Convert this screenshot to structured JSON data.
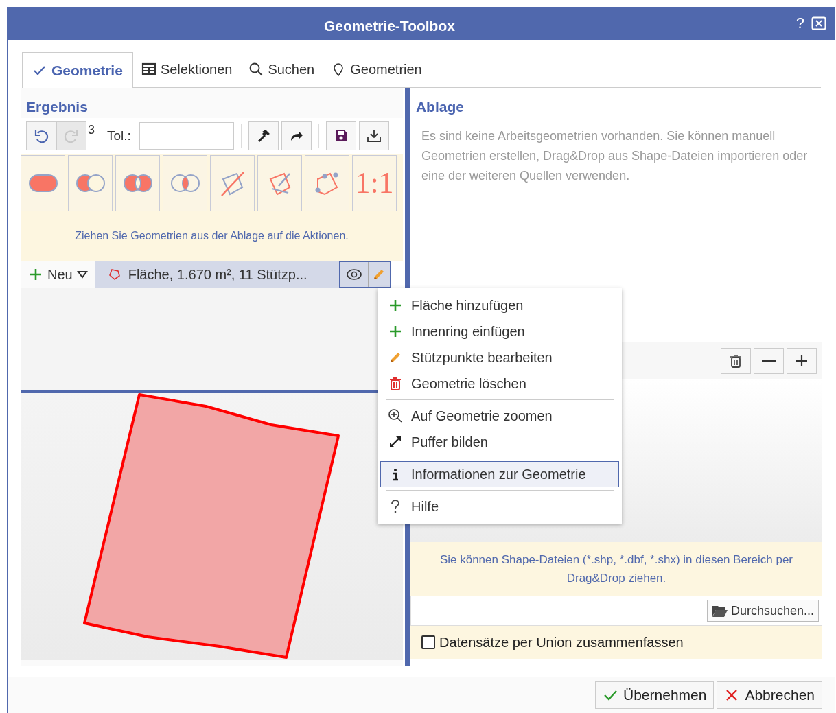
{
  "window": {
    "title": "Geometrie-Toolbox",
    "help": "?"
  },
  "tabs": [
    {
      "label": "Geometrie",
      "kind": "check",
      "selected": true
    },
    {
      "label": "Selektionen",
      "kind": "table",
      "selected": false
    },
    {
      "label": "Suchen",
      "kind": "search",
      "selected": false
    },
    {
      "label": "Geometrien",
      "kind": "pin",
      "selected": false
    }
  ],
  "result": {
    "title": "Ergebnis",
    "undo_count": "3",
    "tolerance_label": "Tol.:",
    "toolbar": [
      {
        "kind": "undo",
        "disabled": false
      },
      {
        "kind": "redo",
        "disabled": true
      }
    ],
    "tools": [
      {
        "kind": "hammer"
      },
      {
        "kind": "share"
      },
      {
        "kind": "save"
      },
      {
        "kind": "download"
      }
    ],
    "actions": [
      {
        "kind": "union"
      },
      {
        "kind": "difference"
      },
      {
        "kind": "symdiff"
      },
      {
        "kind": "intersect"
      },
      {
        "kind": "split"
      },
      {
        "kind": "cut"
      },
      {
        "kind": "vertices"
      },
      {
        "kind": "text",
        "label": "1:1"
      }
    ],
    "hint": "Ziehen Sie Geometrien aus der Ablage auf die Aktionen.",
    "new_button": "Neu",
    "geometry": {
      "label": "Fläche, 1.670 m², 11 Stützp..."
    }
  },
  "menu": [
    [
      {
        "label": "Fläche hinzufügen",
        "kind": "plus",
        "selected": false
      },
      {
        "label": "Innenring einfügen",
        "kind": "plus",
        "selected": false
      },
      {
        "label": "Stützpunkte bearbeiten",
        "kind": "pencil",
        "selected": false
      },
      {
        "label": "Geometrie löschen",
        "kind": "trash",
        "selected": false
      }
    ],
    [
      {
        "label": "Auf Geometrie zoomen",
        "kind": "zoom",
        "selected": false
      },
      {
        "label": "Puffer bilden",
        "kind": "expand",
        "selected": false
      }
    ],
    [
      {
        "label": "Informationen zur Geometrie",
        "kind": "info",
        "selected": true
      }
    ],
    [
      {
        "label": "Hilfe",
        "kind": "help",
        "selected": false
      }
    ]
  ],
  "storage": {
    "title": "Ablage",
    "message": "Es sind keine Arbeitsgeometrien vorhanden. Sie können manuell Geometrien erstellen, Drag&Drop aus Shape-Dateien importieren oder eine der weiteren Quellen verwenden.",
    "tools": [
      {
        "kind": "trash"
      },
      {
        "kind": "minus"
      },
      {
        "kind": "plus"
      }
    ],
    "hint": "Sie können Shape-Dateien (*.shp, *.dbf, *.shx) in diesen Bereich per Drag&Drop ziehen.",
    "browse": "Durchsuchen...",
    "union": {
      "label": "Datensätze per Union zusammenfassen",
      "checked": false
    }
  },
  "footer": [
    {
      "kind": "ok",
      "label": "Übernehmen"
    },
    {
      "kind": "cancel",
      "label": "Abbrechen"
    }
  ]
}
